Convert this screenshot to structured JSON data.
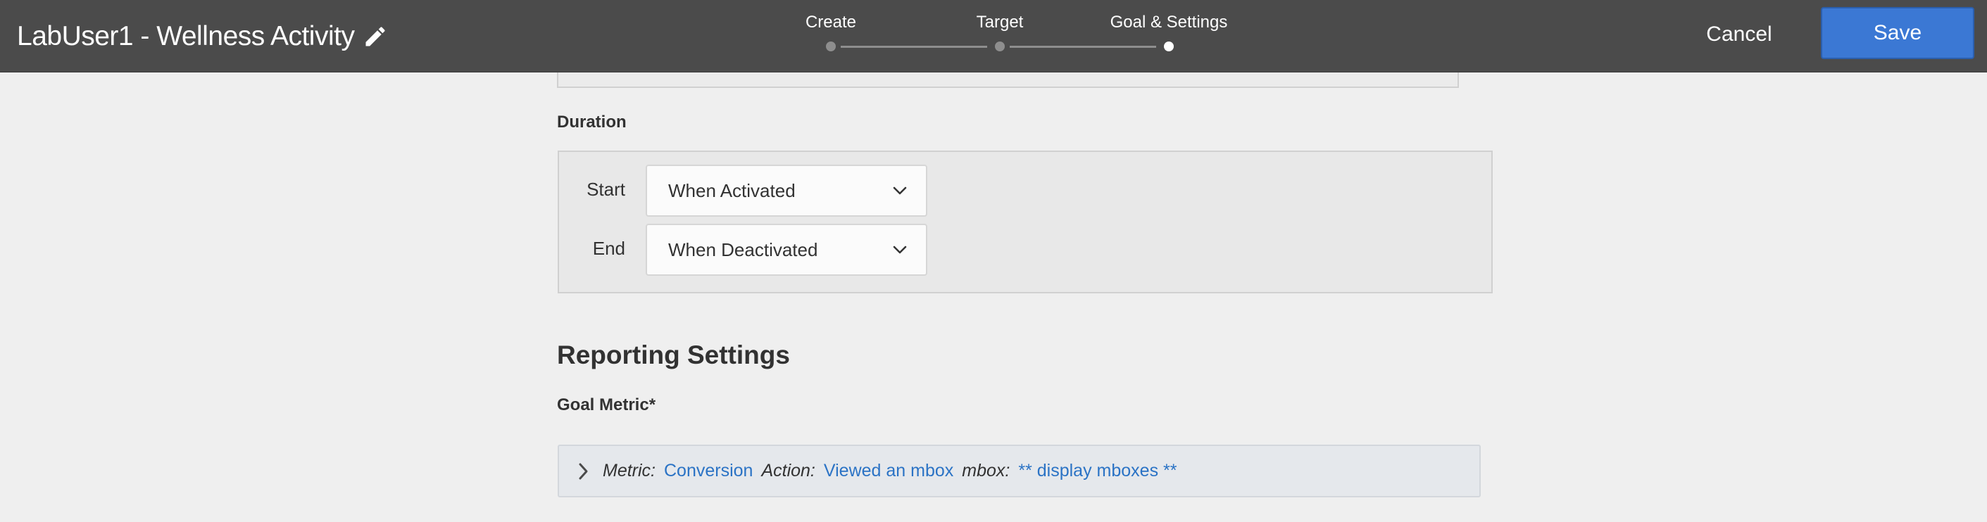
{
  "header": {
    "title": "LabUser1 - Wellness Activity",
    "edit_icon": "pencil-icon",
    "steps": [
      {
        "label": "Create",
        "state": "complete"
      },
      {
        "label": "Target",
        "state": "complete"
      },
      {
        "label": "Goal & Settings",
        "state": "current"
      }
    ],
    "cancel_label": "Cancel",
    "save_label": "Save",
    "save_color": "#3b78d4"
  },
  "duration": {
    "label": "Duration",
    "start_label": "Start",
    "start_value": "When Activated",
    "end_label": "End",
    "end_value": "When Deactivated"
  },
  "reporting": {
    "heading": "Reporting Settings",
    "goal_metric_label": "Goal Metric*",
    "metric_key": "Metric:",
    "metric_value": "Conversion",
    "action_key": "Action:",
    "action_value": "Viewed an mbox",
    "mbox_key": "mbox:",
    "mbox_value": "** display mboxes **",
    "link_color": "#2b73c5"
  }
}
